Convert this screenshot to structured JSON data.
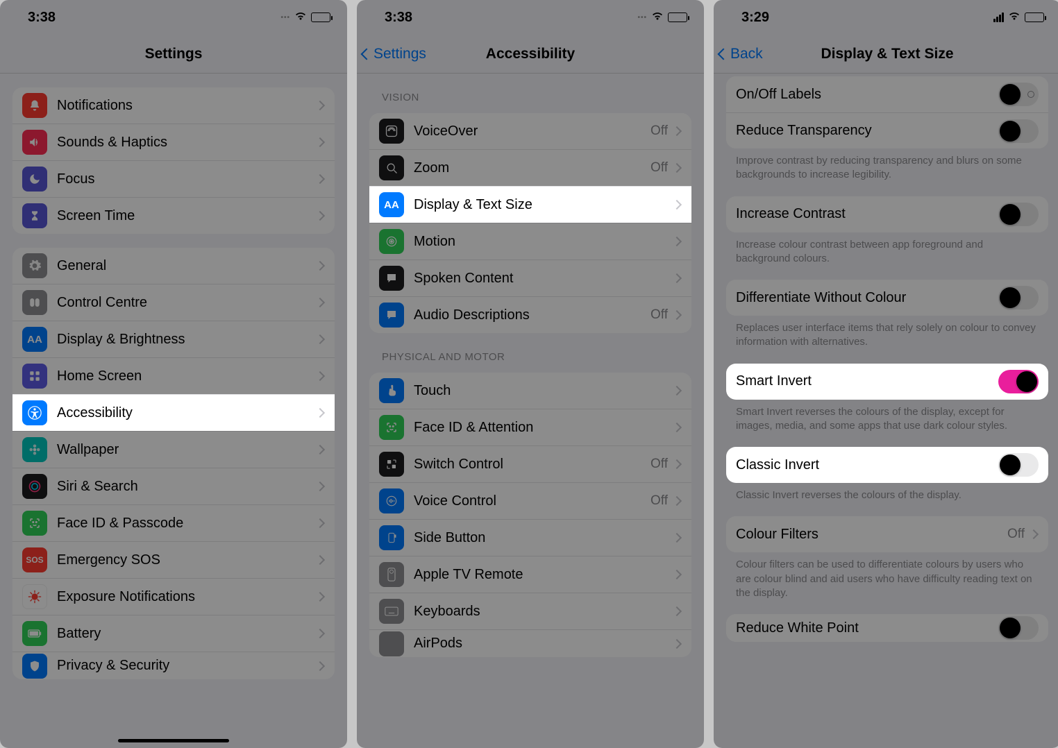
{
  "phone1": {
    "time": "3:38",
    "title": "Settings",
    "group1": [
      {
        "label": "Notifications",
        "icon": "bell",
        "color": "ic-red"
      },
      {
        "label": "Sounds & Haptics",
        "icon": "speaker",
        "color": "ic-pink"
      },
      {
        "label": "Focus",
        "icon": "moon",
        "color": "ic-purple"
      },
      {
        "label": "Screen Time",
        "icon": "hourglass",
        "color": "ic-purple"
      }
    ],
    "group2": [
      {
        "label": "General",
        "icon": "gear",
        "color": "ic-grey"
      },
      {
        "label": "Control Centre",
        "icon": "sliders",
        "color": "ic-grey"
      },
      {
        "label": "Display & Brightness",
        "icon": "AA",
        "color": "ic-blue"
      },
      {
        "label": "Home Screen",
        "icon": "grid",
        "color": "ic-indigo"
      },
      {
        "label": "Accessibility",
        "icon": "access",
        "color": "ic-blue",
        "highlight": true
      },
      {
        "label": "Wallpaper",
        "icon": "flower",
        "color": "ic-teal"
      },
      {
        "label": "Siri & Search",
        "icon": "siri",
        "color": "ic-black"
      },
      {
        "label": "Face ID & Passcode",
        "icon": "face",
        "color": "ic-green"
      },
      {
        "label": "Emergency SOS",
        "icon": "SOS",
        "color": "ic-red"
      },
      {
        "label": "Exposure Notifications",
        "icon": "virus",
        "color": "ic-red"
      },
      {
        "label": "Battery",
        "icon": "battery",
        "color": "ic-green"
      },
      {
        "label": "Privacy & Security",
        "icon": "hand",
        "color": "ic-blue"
      }
    ]
  },
  "phone2": {
    "time": "3:38",
    "back": "Settings",
    "title": "Accessibility",
    "section_vision": "VISION",
    "section_motor": "PHYSICAL AND MOTOR",
    "vision": [
      {
        "label": "VoiceOver",
        "value": "Off",
        "icon": "vo",
        "color": "ic-black"
      },
      {
        "label": "Zoom",
        "value": "Off",
        "icon": "zoom",
        "color": "ic-black"
      },
      {
        "label": "Display & Text Size",
        "icon": "AA",
        "color": "ic-blue",
        "highlight": true
      },
      {
        "label": "Motion",
        "icon": "motion",
        "color": "ic-green"
      },
      {
        "label": "Spoken Content",
        "icon": "speak",
        "color": "ic-black"
      },
      {
        "label": "Audio Descriptions",
        "value": "Off",
        "icon": "audio",
        "color": "ic-blue"
      }
    ],
    "motor": [
      {
        "label": "Touch",
        "icon": "touch",
        "color": "ic-blue"
      },
      {
        "label": "Face ID & Attention",
        "icon": "face",
        "color": "ic-green"
      },
      {
        "label": "Switch Control",
        "value": "Off",
        "icon": "switch",
        "color": "ic-black"
      },
      {
        "label": "Voice Control",
        "value": "Off",
        "icon": "voice",
        "color": "ic-blue"
      },
      {
        "label": "Side Button",
        "icon": "side",
        "color": "ic-blue"
      },
      {
        "label": "Apple TV Remote",
        "icon": "remote",
        "color": "ic-grey"
      },
      {
        "label": "Keyboards",
        "icon": "keyboard",
        "color": "ic-grey"
      },
      {
        "label": "AirPods",
        "icon": "airpods",
        "color": "ic-grey"
      }
    ]
  },
  "phone3": {
    "time": "3:29",
    "back": "Back",
    "title": "Display & Text Size",
    "onoff_label": "On/Off Labels",
    "reduce_trans_label": "Reduce Transparency",
    "reduce_trans_footer": "Improve contrast by reducing transparency and blurs on some backgrounds to increase legibility.",
    "increase_contrast_label": "Increase Contrast",
    "increase_contrast_footer": "Increase colour contrast between app foreground and background colours.",
    "diff_colour_label": "Differentiate Without Colour",
    "diff_colour_footer": "Replaces user interface items that rely solely on colour to convey information with alternatives.",
    "smart_invert_label": "Smart Invert",
    "smart_invert_footer": "Smart Invert reverses the colours of the display, except for images, media, and some apps that use dark colour styles.",
    "classic_invert_label": "Classic Invert",
    "classic_invert_footer": "Classic Invert reverses the colours of the display.",
    "colour_filters_label": "Colour Filters",
    "colour_filters_value": "Off",
    "colour_filters_footer": "Colour filters can be used to differentiate colours by users who are colour blind and aid users who have difficulty reading text on the display.",
    "reduce_white_label": "Reduce White Point"
  }
}
